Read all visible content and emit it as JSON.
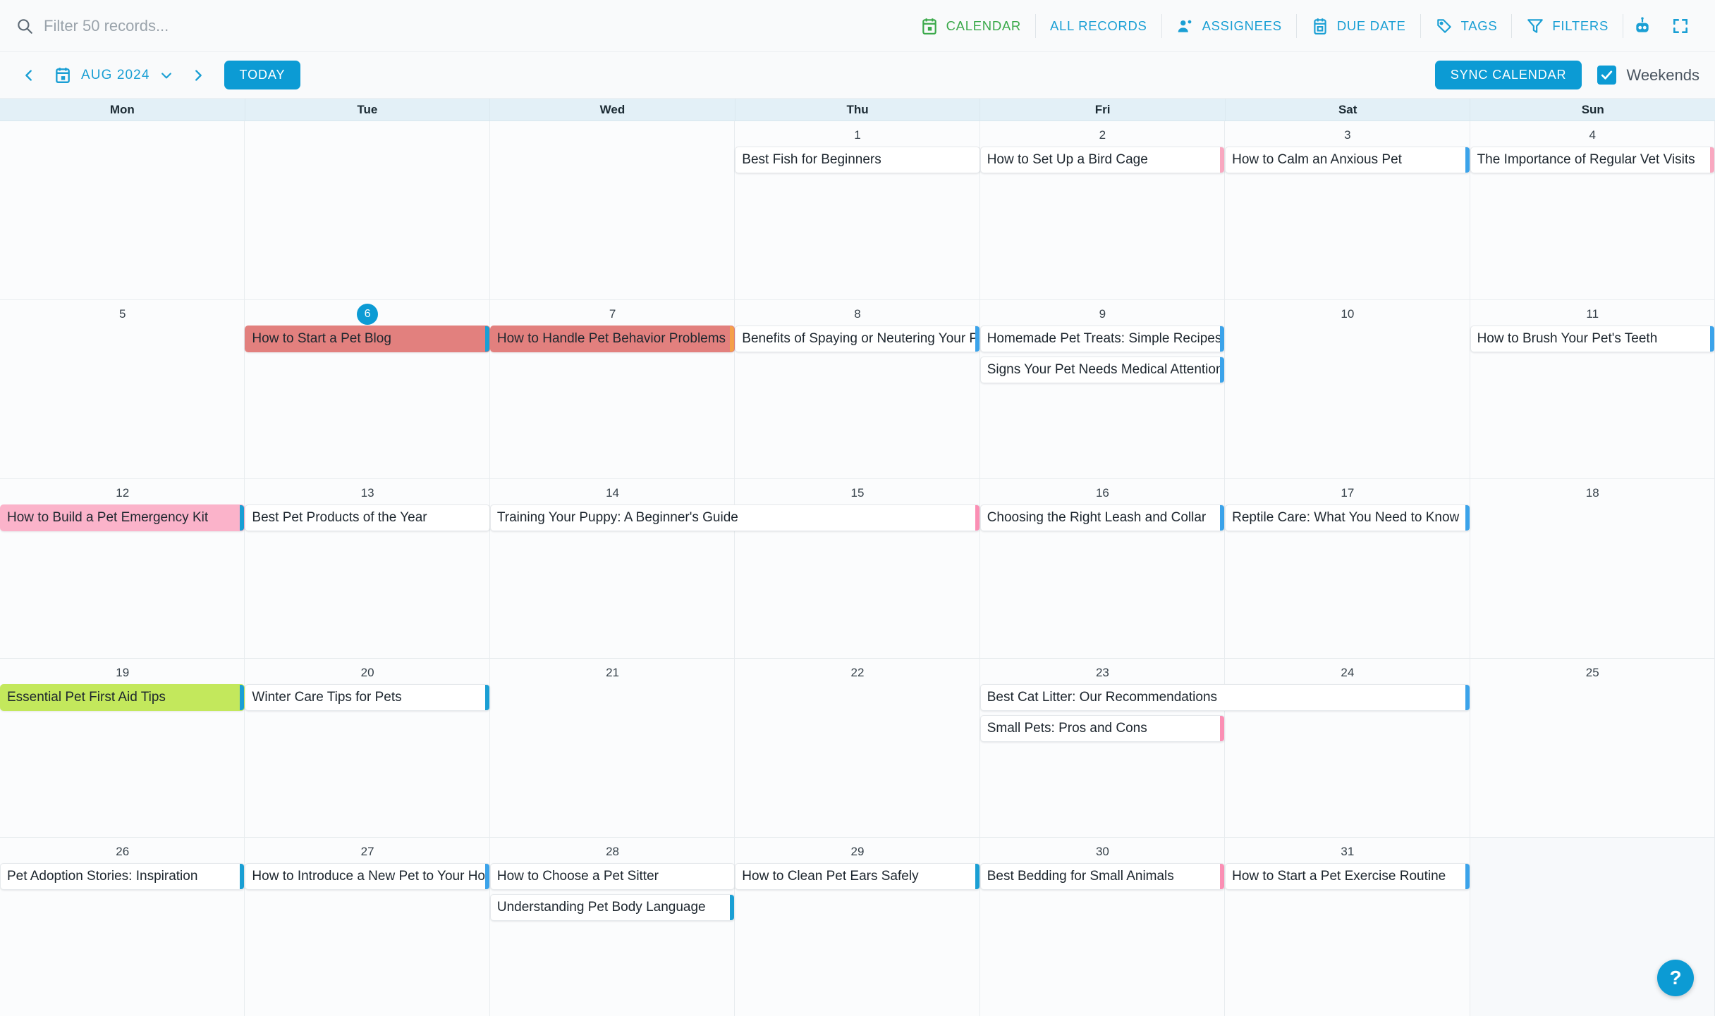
{
  "search": {
    "placeholder": "Filter 50 records...",
    "value": "",
    "icon": "search-icon"
  },
  "toolbar": {
    "items": [
      {
        "label": "CALENDAR",
        "icon": "calendar-icon",
        "active": true
      },
      {
        "label": "ALL RECORDS",
        "icon": "",
        "active": false
      },
      {
        "label": "ASSIGNEES",
        "icon": "people-icon",
        "active": false
      },
      {
        "label": "DUE DATE",
        "icon": "calendar-icon",
        "active": false
      },
      {
        "label": "TAGS",
        "icon": "tag-icon",
        "active": false
      },
      {
        "label": "FILTERS",
        "icon": "funnel-icon",
        "active": false
      }
    ],
    "robot_icon": "robot-icon",
    "expand_icon": "expand-icon"
  },
  "navbar": {
    "prev_icon": "chevron-left-icon",
    "next_icon": "chevron-right-icon",
    "calendar_icon": "calendar-icon",
    "month_label": "AUG 2024",
    "dropdown_icon": "chevron-down-icon",
    "today_label": "TODAY",
    "sync_label": "SYNC CALENDAR",
    "weekends_label": "Weekends",
    "weekends_checked": true
  },
  "calendar": {
    "day_headers": [
      "Mon",
      "Tue",
      "Wed",
      "Thu",
      "Fri",
      "Sat",
      "Sun"
    ],
    "today": 6,
    "weeks": [
      {
        "days": [
          {
            "num": "",
            "blank": true
          },
          {
            "num": "",
            "blank": true
          },
          {
            "num": "",
            "blank": true
          },
          {
            "num": "1"
          },
          {
            "num": "2"
          },
          {
            "num": "3"
          },
          {
            "num": "4"
          }
        ],
        "events": [
          {
            "title": "Best Fish for Beginners",
            "col": 3,
            "span": 1,
            "row": 0,
            "stripe": "#ffffff",
            "fill": "#ffffff"
          },
          {
            "title": "How to Set Up a Bird Cage",
            "col": 4,
            "span": 1,
            "row": 0,
            "stripe": "#f9a8c0",
            "fill": "#ffffff"
          },
          {
            "title": "How to Calm an Anxious Pet",
            "col": 5,
            "span": 1,
            "row": 0,
            "stripe": "#3ba3ea",
            "fill": "#ffffff"
          },
          {
            "title": "The Importance of Regular Vet Visits",
            "col": 6,
            "span": 1,
            "row": 0,
            "stripe": "#f9a8c0",
            "fill": "#ffffff",
            "leftstripe": "#3ba3ea"
          }
        ]
      },
      {
        "days": [
          {
            "num": "5"
          },
          {
            "num": "6",
            "today": true
          },
          {
            "num": "7"
          },
          {
            "num": "8"
          },
          {
            "num": "9"
          },
          {
            "num": "10"
          },
          {
            "num": "11"
          }
        ],
        "events": [
          {
            "title": "How to Start a Pet Blog",
            "col": 1,
            "span": 1,
            "row": 0,
            "stripe": "#1a9fd4",
            "fill": "#e2807e"
          },
          {
            "title": "How to Handle Pet Behavior Problems",
            "col": 2,
            "span": 1,
            "row": 0,
            "stripe": "#f5a04a",
            "fill": "#e2807e"
          },
          {
            "title": "Benefits of Spaying or Neutering Your Pet",
            "col": 3,
            "span": 1,
            "row": 0,
            "stripe": "#3ba3ea",
            "fill": "#ffffff"
          },
          {
            "title": "Homemade Pet Treats: Simple Recipes",
            "col": 4,
            "span": 1,
            "row": 0,
            "stripe": "#3ba3ea",
            "fill": "#ffffff"
          },
          {
            "title": "Signs Your Pet Needs Medical Attention",
            "col": 4,
            "span": 1,
            "row": 1,
            "stripe": "#3ba3ea",
            "fill": "#ffffff"
          },
          {
            "title": "How to Brush Your Pet's Teeth",
            "col": 6,
            "span": 1,
            "row": 0,
            "stripe": "#3ba3ea",
            "fill": "#ffffff"
          }
        ]
      },
      {
        "days": [
          {
            "num": "12"
          },
          {
            "num": "13"
          },
          {
            "num": "14"
          },
          {
            "num": "15"
          },
          {
            "num": "16"
          },
          {
            "num": "17"
          },
          {
            "num": "18"
          }
        ],
        "events": [
          {
            "title": "How to Build a Pet Emergency Kit",
            "col": 0,
            "span": 1,
            "row": 0,
            "stripe": "#1a9fd4",
            "fill": "#fbb3ca"
          },
          {
            "title": "Best Pet Products of the Year",
            "col": 1,
            "span": 1,
            "row": 0,
            "stripe": "#ffffff",
            "fill": "#ffffff"
          },
          {
            "title": "Training Your Puppy: A Beginner's Guide",
            "col": 2,
            "span": 2,
            "row": 0,
            "stripe": "#fb8fb4",
            "fill": "#ffffff"
          },
          {
            "title": "Choosing the Right Leash and Collar",
            "col": 4,
            "span": 1,
            "row": 0,
            "stripe": "#3ba3ea",
            "fill": "#ffffff"
          },
          {
            "title": "Reptile Care: What You Need to Know",
            "col": 5,
            "span": 1,
            "row": 0,
            "stripe": "#3ba3ea",
            "fill": "#ffffff"
          }
        ]
      },
      {
        "days": [
          {
            "num": "19"
          },
          {
            "num": "20"
          },
          {
            "num": "21"
          },
          {
            "num": "22"
          },
          {
            "num": "23"
          },
          {
            "num": "24"
          },
          {
            "num": "25"
          }
        ],
        "events": [
          {
            "title": "Essential Pet First Aid Tips",
            "col": 0,
            "span": 1,
            "row": 0,
            "stripe": "#1a9fd4",
            "fill": "#c3e85c"
          },
          {
            "title": "Winter Care Tips for Pets",
            "col": 1,
            "span": 1,
            "row": 0,
            "stripe": "#1a9fd4",
            "fill": "#ffffff"
          },
          {
            "title": "Best Cat Litter: Our Recommendations",
            "col": 4,
            "span": 2,
            "row": 0,
            "stripe": "#3ba3ea",
            "fill": "#ffffff"
          },
          {
            "title": "Small Pets: Pros and Cons",
            "col": 4,
            "span": 1,
            "row": 1,
            "stripe": "#fb8fb4",
            "fill": "#ffffff"
          }
        ]
      },
      {
        "days": [
          {
            "num": "26"
          },
          {
            "num": "27"
          },
          {
            "num": "28"
          },
          {
            "num": "29"
          },
          {
            "num": "30"
          },
          {
            "num": "31"
          },
          {
            "num": "",
            "blank": true,
            "other": true
          }
        ],
        "events": [
          {
            "title": "Pet Adoption Stories: Inspiration",
            "col": 0,
            "span": 1,
            "row": 0,
            "stripe": "#1a9fd4",
            "fill": "#ffffff"
          },
          {
            "title": "How to Introduce a New Pet to Your Home",
            "col": 1,
            "span": 1,
            "row": 0,
            "stripe": "#3ba3ea",
            "fill": "#ffffff"
          },
          {
            "title": "How to Choose a Pet Sitter",
            "col": 2,
            "span": 1,
            "row": 0,
            "stripe": "#ffffff",
            "fill": "#ffffff"
          },
          {
            "title": "Understanding Pet Body Language",
            "col": 2,
            "span": 1,
            "row": 1,
            "stripe": "#1a9fd4",
            "fill": "#ffffff"
          },
          {
            "title": "How to Clean Pet Ears Safely",
            "col": 3,
            "span": 1,
            "row": 0,
            "stripe": "#1a9fd4",
            "fill": "#ffffff"
          },
          {
            "title": "Best Bedding for Small Animals",
            "col": 4,
            "span": 1,
            "row": 0,
            "stripe": "#fb8fb4",
            "fill": "#ffffff"
          },
          {
            "title": "How to Start a Pet Exercise Routine",
            "col": 5,
            "span": 1,
            "row": 0,
            "stripe": "#3ba3ea",
            "fill": "#ffffff"
          }
        ]
      }
    ]
  },
  "help": {
    "label": "?"
  },
  "colors": {
    "accent": "#0c9bd4",
    "active_tab": "#3aa94a",
    "header_bg": "#e3f0f7"
  }
}
